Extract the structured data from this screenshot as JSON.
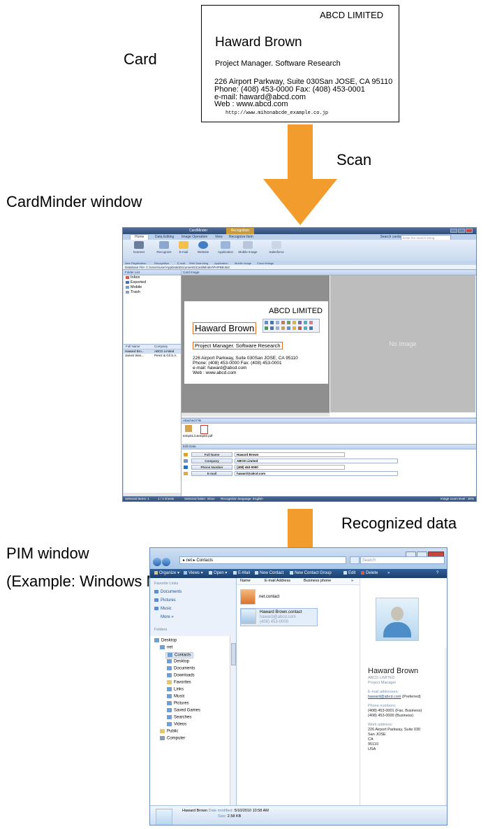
{
  "labels": {
    "card": "Card",
    "scan": "Scan",
    "cardminder_window": "CardMinder window",
    "recognized_data": "Recognized data",
    "pim_window": "PIM window",
    "pim_example": "(Example: Windows Mail)"
  },
  "card": {
    "company": "ABCD LIMITED",
    "name": "Haward Brown",
    "title": "Project Manager. Software Research",
    "address": "226 Airport Parkway, Suite 030San JOSE, CA 95110",
    "phone": "Phone: (408) 453-0000      Fax: (408) 453-0001",
    "email": "e-mail: haward@abcd.com",
    "web": "Web   : www.abcd.com",
    "url": "http://www.mihonabcde_example.co.jp"
  },
  "cardminder": {
    "window_title": "CardMinder",
    "context_tab": "Recognition",
    "tabs": [
      "Home",
      "Data Editing",
      "Image Operation",
      "View",
      "Recognize Item"
    ],
    "search_label": "Search cards",
    "search_placeholder": "Enter the search string",
    "ribbon_buttons": [
      "Scanner",
      "Recognize",
      "E-mail",
      "Website",
      "Application",
      "Mobile Image",
      "Salesforce"
    ],
    "ribbon_groups": [
      "New Registration",
      "Recognition",
      "E-mail",
      "Web Searching",
      "Application",
      "Mobile Image",
      "Cloud linkage"
    ],
    "database_path": "Database File: C:\\Users\\user\\AppData\\Documents\\CardMinder\\PHPBB.BIZ",
    "folder_list_title": "Folder List",
    "folders": [
      "Inbox",
      "Exported",
      "Mobile",
      "Trash"
    ],
    "list_columns": [
      "Full Name",
      "Company"
    ],
    "list_rows": [
      {
        "name": "Haward Bro...",
        "company": "ABCD Limited"
      },
      {
        "name": "James Wos...",
        "company": "Perez & Gil S.A."
      }
    ],
    "card_image_title": "Card Image",
    "no_image": "No Image",
    "attached_title": "Attached File",
    "attachments": [
      "temp01.b...",
      "temp02.pdf"
    ],
    "edit_data_title": "Edit Data",
    "fields": [
      {
        "label": "Full Name",
        "value": "Haward Brown",
        "color": "#e0a22a"
      },
      {
        "label": "Company",
        "value": "ABCD Limited",
        "color": "#6f93c6"
      },
      {
        "label": "Phone Number",
        "value": "(408) 453-0000",
        "color": "#2f6fb8"
      },
      {
        "label": "E-mail",
        "value": "haward@abcd.com",
        "color": "#e7a54a"
      }
    ],
    "status": {
      "selected": "Selected Items:   1",
      "sheets": "1 /    2 sheets",
      "folder": "Selected folder: Inbox",
      "language": "Recognition language: English",
      "zoom": "Image zoom level : 30%"
    }
  },
  "windows_mail": {
    "breadcrumb": "▸ net ▸ Contacts",
    "search_placeholder": "Search",
    "toolbar": [
      "Organize ▾",
      "Views ▾",
      "Open ▾",
      "E-Mail",
      "New Contact",
      "New Contact Group",
      "Edit",
      "Delete",
      "»"
    ],
    "favorite_links_title": "Favorite Links",
    "favorite_links": [
      "Documents",
      "Pictures",
      "Music",
      "More »"
    ],
    "folders_title": "Folders",
    "tree": [
      "Desktop",
      "net",
      "Contacts",
      "Desktop",
      "Documents",
      "Downloads",
      "Favorites",
      "Links",
      "Music",
      "Pictures",
      "Saved Games",
      "Searches",
      "Videos",
      "Public",
      "Computer"
    ],
    "columns": [
      "Name",
      "E-mail Address",
      "Business phone",
      "»"
    ],
    "items": [
      {
        "name": "net.contact"
      },
      {
        "name": "Haward Brown.contact",
        "email": "haward@abcd.com",
        "phone": "(408) 453-0000"
      }
    ],
    "preview": {
      "name": "Haward Brown",
      "company": "ABCD LIMITED",
      "title": "Project Manager",
      "email_heading": "E-mail addresses:",
      "email": "haward@abcd.com",
      "email_note": " (Preferred)",
      "phone_heading": "Phone numbers:",
      "phone1": "(408) 453-0001 (Fax, Business)",
      "phone2": "(408) 453-0000 (Business)",
      "address_heading": "Work address:",
      "address": [
        "226 Airport Parkway, Suite 030",
        "San JOSE",
        "CA",
        "95110",
        "USA"
      ]
    },
    "details": {
      "name": "Haward Brown",
      "modified_label": "Date modified:",
      "modified": "5/10/2010 10:58 AM",
      "size_label": "Size:",
      "size": "2.58 KB"
    }
  },
  "colors": {
    "arrow": "#f29c2d",
    "highlight": "#e46b1c"
  }
}
